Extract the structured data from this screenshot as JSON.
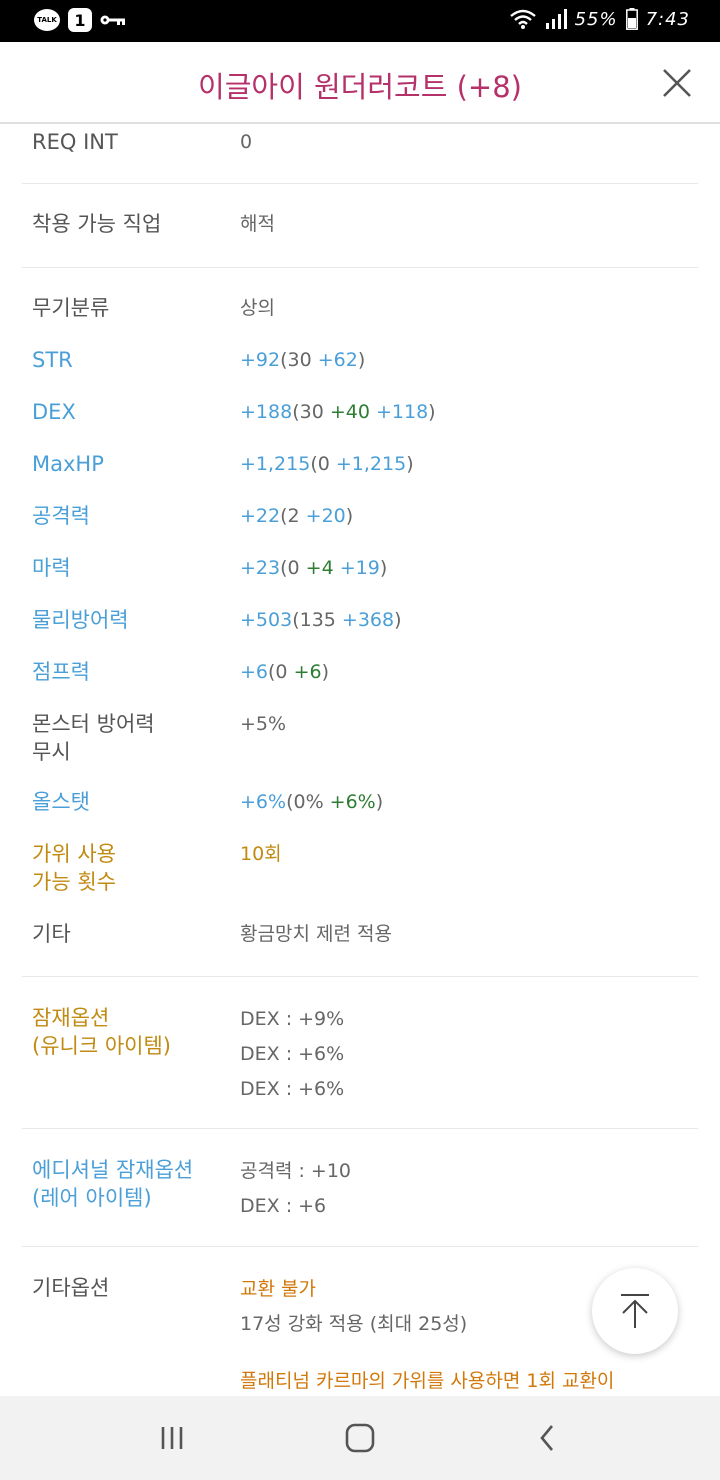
{
  "status_bar": {
    "talk_badge": "TALK",
    "notification_count": "1",
    "battery": "55%",
    "time": "7:43",
    "icons": [
      "kakaotalk-icon",
      "key-icon",
      "wifi-icon",
      "signal-icon",
      "battery-icon"
    ]
  },
  "header": {
    "title": "이글아이 원더러코트 (+8)",
    "close_icon": "close-icon"
  },
  "colors": {
    "title": "#b5316a",
    "stat_blue": "#4a9fd8",
    "stat_green": "#2e7d32",
    "label_gold": "#c18a12",
    "value_orange": "#d2780a"
  },
  "item": {
    "req_int": {
      "label": "REQ INT",
      "value": "0"
    },
    "job": {
      "label": "착용 가능 직업",
      "value": "해적"
    },
    "category": {
      "label": "무기분류",
      "value": "상의"
    },
    "str": {
      "label": "STR",
      "total": "+92",
      "base": "(30 ",
      "star": "+62",
      "close": ")"
    },
    "dex": {
      "label": "DEX",
      "total": "+188",
      "base": "(30 ",
      "flame": "+40",
      "star": " +118",
      "close": ")"
    },
    "maxhp": {
      "label": "MaxHP",
      "total": "+1,215",
      "base": "(0 ",
      "star": "+1,215",
      "close": ")"
    },
    "att": {
      "label": "공격력",
      "total": "+22",
      "base": "(2 ",
      "star": "+20",
      "close": ")"
    },
    "matt": {
      "label": "마력",
      "total": "+23",
      "base": "(0 ",
      "flame": "+4",
      "star": " +19",
      "close": ")"
    },
    "def": {
      "label": "물리방어력",
      "total": "+503",
      "base": "(135 ",
      "star": "+368",
      "close": ")"
    },
    "jump": {
      "label": "점프력",
      "total": "+6",
      "base": "(0 ",
      "flame": "+6",
      "close": ")"
    },
    "ignore_def": {
      "label_line1": "몬스터 방어력",
      "label_line2": "무시",
      "value": "+5%"
    },
    "allstat": {
      "label": "올스탯",
      "total": "+6%",
      "base": "(0% ",
      "flame": "+6%",
      "close": ")"
    },
    "scissors": {
      "label_line1": "가위 사용",
      "label_line2": "가능 횟수",
      "value": "10회"
    },
    "etc": {
      "label": "기타",
      "value": "황금망치 제련 적용"
    },
    "potential": {
      "label_line1": "잠재옵션",
      "label_line2": "(유니크 아이템)",
      "lines": [
        "DEX : +9%",
        "DEX : +6%",
        "DEX : +6%"
      ]
    },
    "additional": {
      "label_line1": "에디셔널 잠재옵션",
      "label_line2": "(레어 아이템)",
      "lines": [
        "공격력 : +10",
        "DEX : +6"
      ]
    },
    "other_options": {
      "label": "기타옵션",
      "trade": "교환 불가",
      "starforce": "17성 강화 적용 (최대 25성)",
      "platinum": "플래티넘 카르마의 가위를 사용하면 1회 교환이"
    }
  },
  "scroll_top_icon": "arrow-up-icon",
  "nav": {
    "recents_icon": "recents-icon",
    "home_icon": "home-icon",
    "back_icon": "back-icon"
  }
}
